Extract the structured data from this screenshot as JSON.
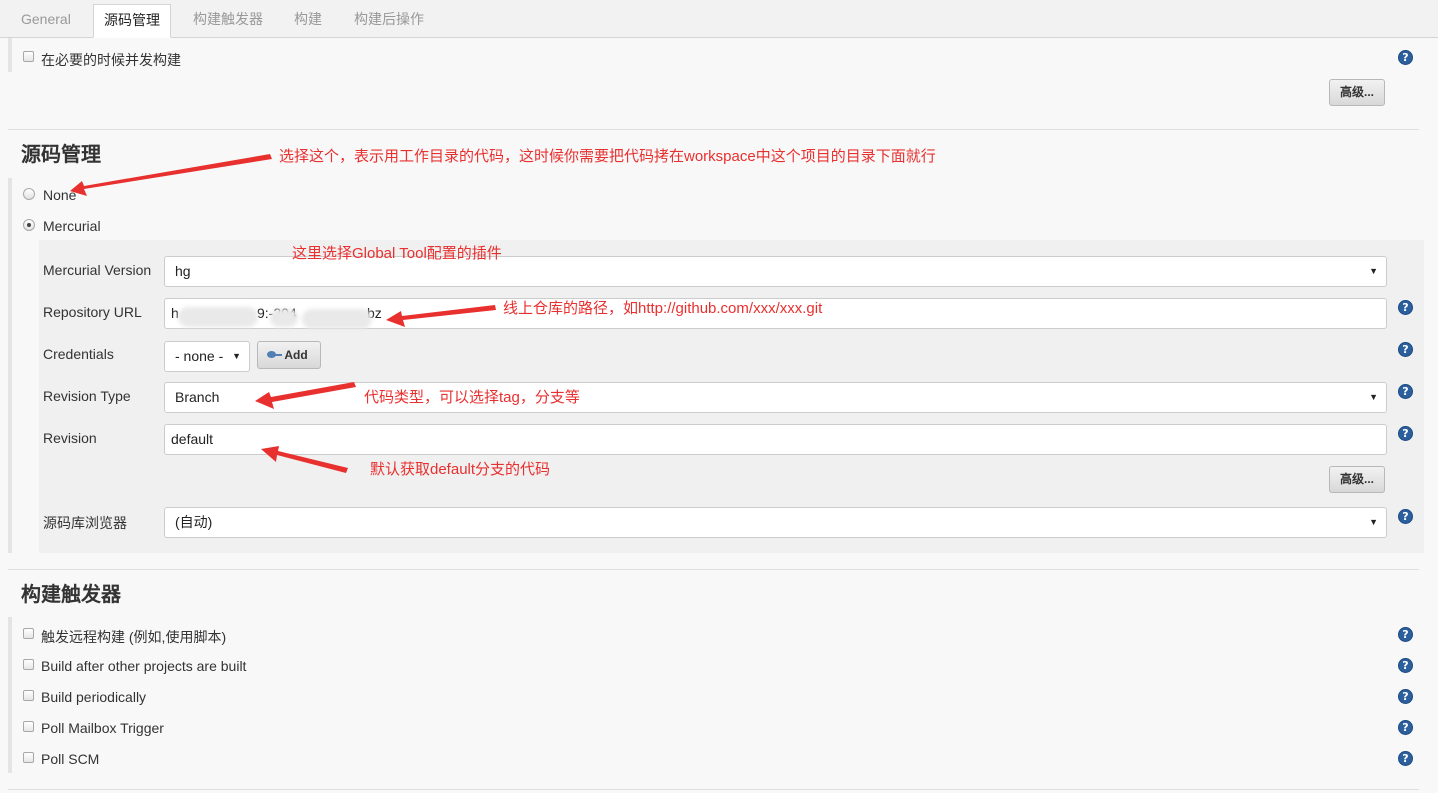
{
  "tabs": [
    {
      "label": "General"
    },
    {
      "label": "源码管理"
    },
    {
      "label": "构建触发器"
    },
    {
      "label": "构建"
    },
    {
      "label": "构建后操作"
    }
  ],
  "general": {
    "concurrent_label": "在必要的时候并发构建",
    "advanced_label": "高级..."
  },
  "scm": {
    "title": "源码管理",
    "none_label": "None",
    "mercurial_label": "Mercurial",
    "fields": {
      "version_label": "Mercurial Version",
      "version_value": "hg",
      "repo_label": "Repository URL",
      "repo_value_start": "h",
      "repo_value_mid": "9:-204",
      "repo_value_end": "bz",
      "credentials_label": "Credentials",
      "credentials_value": "- none -",
      "add_label": "Add",
      "revision_type_label": "Revision Type",
      "revision_type_value": "Branch",
      "revision_label": "Revision",
      "revision_value": "default",
      "advanced_label": "高级...",
      "browser_label": "源码库浏览器",
      "browser_value": "(自动)"
    }
  },
  "triggers": {
    "title": "构建触发器",
    "items": [
      {
        "label": "触发远程构建 (例如,使用脚本)"
      },
      {
        "label": "Build after other projects are built"
      },
      {
        "label": "Build periodically"
      },
      {
        "label": "Poll Mailbox Trigger"
      },
      {
        "label": "Poll SCM"
      }
    ]
  },
  "annotations": {
    "none_note": "选择这个，表示用工作目录的代码，这时候你需要把代码拷在workspace中这个项目的目录下面就行",
    "tool_note": "这里选择Global Tool配置的插件",
    "repo_note": "线上仓库的路径，如http://github.com/xxx/xxx.git",
    "type_note": "代码类型，可以选择tag，分支等",
    "revision_note": "默认获取default分支的代码"
  },
  "colors": {
    "annotation": "#e8302f",
    "help_icon": "#2c5f9e",
    "background": "#f8f8f8"
  }
}
